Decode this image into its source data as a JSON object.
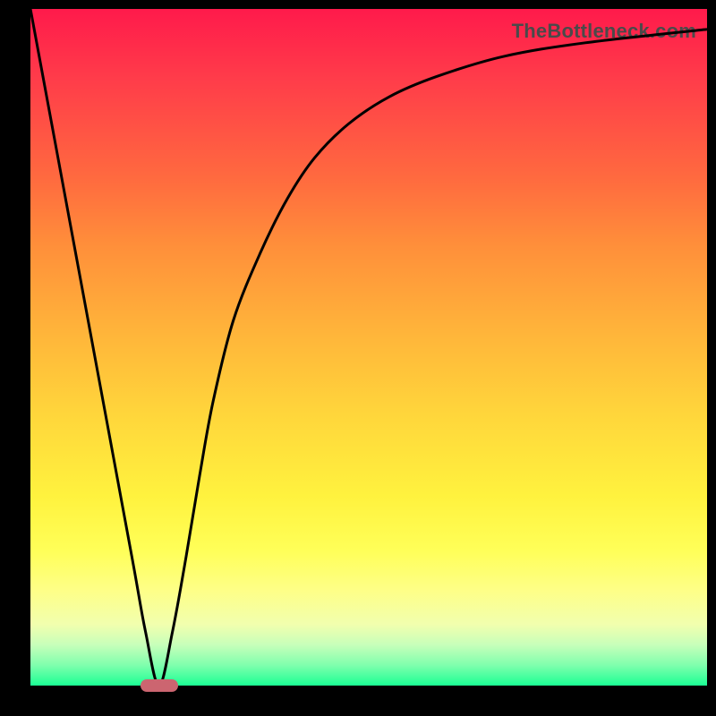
{
  "watermark": "TheBottleneck.com",
  "colors": {
    "frame": "#000000",
    "curve": "#000000",
    "marker": "#cc6570",
    "gradient_top": "#ff1a4b",
    "gradient_bottom": "#1bff94"
  },
  "chart_data": {
    "type": "line",
    "title": "",
    "xlabel": "",
    "ylabel": "",
    "xlim": [
      0,
      100
    ],
    "ylim": [
      0,
      100
    ],
    "grid": false,
    "series": [
      {
        "name": "bottleneck-curve",
        "x": [
          0,
          5,
          10,
          15,
          17,
          19,
          21,
          23,
          25,
          27,
          30,
          34,
          38,
          42,
          47,
          53,
          60,
          70,
          82,
          100
        ],
        "y": [
          100,
          73,
          46,
          19,
          8,
          0,
          8,
          19,
          31,
          42,
          54,
          64,
          72,
          78,
          83,
          87,
          90,
          93,
          95,
          97
        ]
      }
    ],
    "annotations": [
      {
        "name": "optimal-marker",
        "x": 19,
        "y": 0
      }
    ]
  }
}
